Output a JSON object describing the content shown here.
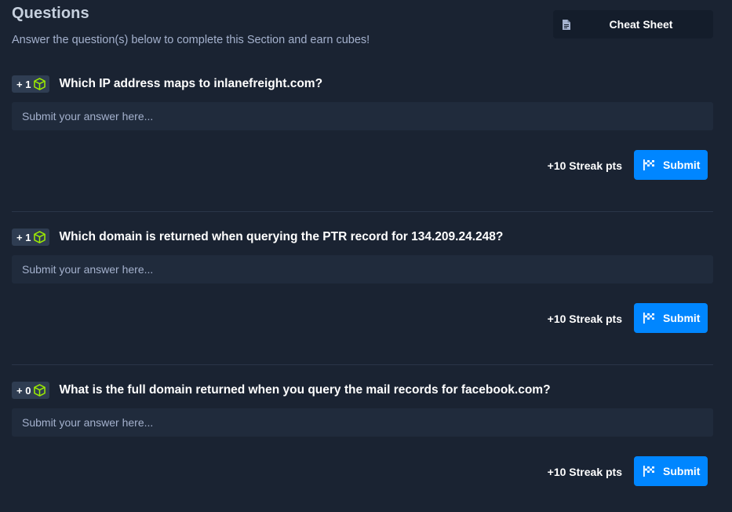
{
  "header": {
    "title": "Questions",
    "subtitle": "Answer the question(s) below to complete this Section and earn cubes!",
    "cheat_sheet_label": "Cheat Sheet",
    "cheat_sheet_icon": "document-icon"
  },
  "questions": [
    {
      "points": "+ 1",
      "text": "Which IP address maps to inlanefreight.com?",
      "placeholder": "Submit your answer here...",
      "value": "",
      "streak": "+10 Streak pts",
      "submit_label": "Submit"
    },
    {
      "points": "+ 1",
      "text": "Which domain is returned when querying the PTR record for 134.209.24.248?",
      "placeholder": "Submit your answer here...",
      "value": "",
      "streak": "+10 Streak pts",
      "submit_label": "Submit"
    },
    {
      "points": "+ 0",
      "text": "What is the full domain returned when you query the mail records for facebook.com?",
      "placeholder": "Submit your answer here...",
      "value": "",
      "streak": "+10 Streak pts",
      "submit_label": "Submit"
    }
  ],
  "icons": {
    "badge_icon": "cube-icon",
    "submit_icon": "flag-icon"
  },
  "colors": {
    "background": "#1a2332",
    "panel": "#141d2b",
    "input": "#202b3c",
    "badge": "#2f3d52",
    "accent_blue": "#0086ff",
    "cube_green": "#9fef00",
    "muted_text": "#a4b1cd"
  }
}
